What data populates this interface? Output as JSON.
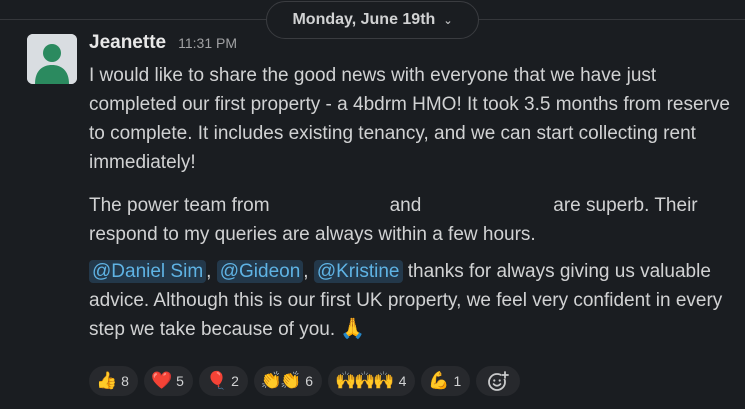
{
  "date_divider": {
    "label": "Monday, June 19th",
    "chevron_icon": "chevron-down-icon"
  },
  "message": {
    "author": "Jeanette",
    "time": "11:31 PM",
    "avatar_icon": "default-user-avatar",
    "paragraph1": "I would like to share the good news with everyone that we have just completed our first property - a 4bdrm HMO! It took 3.5 months from reserve to complete. It includes existing tenancy, and we can start collecting rent immediately!",
    "paragraph2": {
      "part1": "The power team from",
      "part2": "and",
      "part3": "are superb. Their respond to my queries are always within a few hours."
    },
    "paragraph3": {
      "mentions": [
        "@Daniel Sim",
        "@Gideon",
        "@Kristine"
      ],
      "sep1": ",",
      "sep2": ",",
      "text": "thanks for always giving us valuable advice. Although this is our first UK property, we feel very confident in every step we take because of you.",
      "emoji": "🙏"
    }
  },
  "reactions": [
    {
      "emoji": "👍",
      "count": "8",
      "icon": "thumbs-up-icon"
    },
    {
      "emoji": "❤️",
      "count": "5",
      "icon": "heart-icon"
    },
    {
      "emoji": "🎈",
      "count": "2",
      "icon": "balloon-icon"
    },
    {
      "emoji": "👏👏",
      "count": "6",
      "icon": "clap-icon"
    },
    {
      "emoji": "🙌🙌🙌",
      "count": "4",
      "icon": "raised-hands-icon"
    },
    {
      "emoji": "💪",
      "count": "1",
      "icon": "flexed-biceps-icon"
    }
  ],
  "add_reaction_icon": "add-reaction-icon",
  "colors": {
    "background": "#1a1d21",
    "text": "#d1d2d3",
    "mention_bg": "#23384a",
    "mention_text": "#5fb3e4",
    "reaction_bg": "#27292d"
  }
}
